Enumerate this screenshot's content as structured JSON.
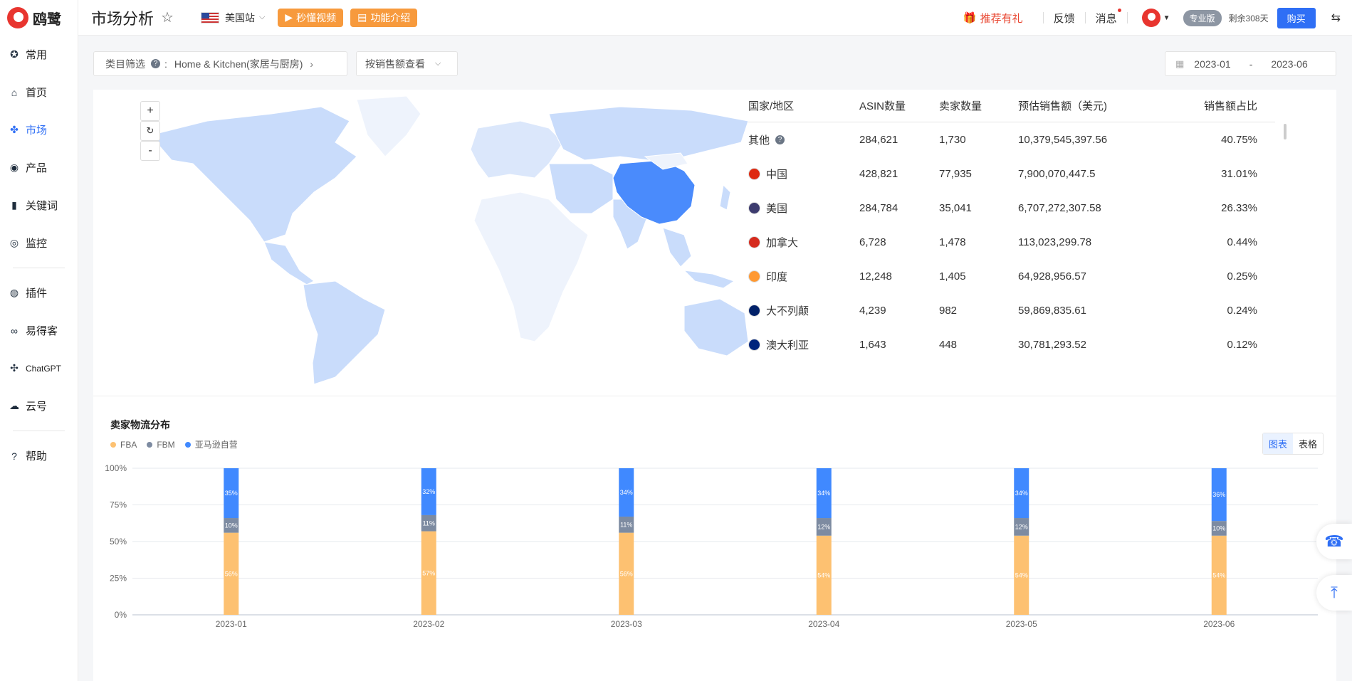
{
  "app": {
    "logo_text": "鸥鹭"
  },
  "sidebar": {
    "items": [
      {
        "label": "常用",
        "icon": "star-icon",
        "glyph": "✪"
      },
      {
        "label": "首页",
        "icon": "home-icon",
        "glyph": "⌂"
      },
      {
        "label": "市场",
        "icon": "grid-icon",
        "glyph": "✤"
      },
      {
        "label": "产品",
        "icon": "eye-icon",
        "glyph": "◉"
      },
      {
        "label": "关键词",
        "icon": "bar-chart-icon",
        "glyph": "▮"
      },
      {
        "label": "监控",
        "icon": "monitor-icon",
        "glyph": "◎"
      }
    ],
    "items2": [
      {
        "label": "插件",
        "icon": "chrome-icon",
        "glyph": "◍"
      },
      {
        "label": "易得客",
        "icon": "link-icon",
        "glyph": "∞"
      },
      {
        "label": "ChatGPT",
        "icon": "chatgpt-icon",
        "glyph": "✣"
      },
      {
        "label": "云号",
        "icon": "cloud-icon",
        "glyph": "☁"
      }
    ],
    "items3": [
      {
        "label": "帮助",
        "icon": "help-icon",
        "glyph": "?"
      }
    ]
  },
  "header": {
    "title": "市场分析",
    "site": "美国站",
    "btn_video": "秒懂视频",
    "btn_intro": "功能介绍",
    "gift": "推荐有礼",
    "feedback": "反馈",
    "messages": "消息",
    "plan": "专业版",
    "days_left": "剩余308天",
    "buy": "购买"
  },
  "filters": {
    "category_label": "类目筛选",
    "category_value": "Home & Kitchen(家居与厨房)",
    "view_mode": "按销售额查看",
    "date_start": "2023-01",
    "date_sep": "-",
    "date_end": "2023-06"
  },
  "table": {
    "headers": [
      "国家/地区",
      "ASIN数量",
      "卖家数量",
      "预估销售额（美元)",
      "销售额占比"
    ],
    "rows": [
      {
        "country": "其他",
        "asin": "284,621",
        "sellers": "1,730",
        "sales": "10,379,545,397.56",
        "share": "40.75%",
        "flag": "help"
      },
      {
        "country": "中国",
        "asin": "428,821",
        "sellers": "77,935",
        "sales": "7,900,070,447.5",
        "share": "31.01%",
        "flag": "#de2910"
      },
      {
        "country": "美国",
        "asin": "284,784",
        "sellers": "35,041",
        "sales": "6,707,272,307.58",
        "share": "26.33%",
        "flag": "#3c3b6e"
      },
      {
        "country": "加拿大",
        "asin": "6,728",
        "sellers": "1,478",
        "sales": "113,023,299.78",
        "share": "0.44%",
        "flag": "#d52b1e"
      },
      {
        "country": "印度",
        "asin": "12,248",
        "sellers": "1,405",
        "sales": "64,928,956.57",
        "share": "0.25%",
        "flag": "#ff9933"
      },
      {
        "country": "大不列颠",
        "asin": "4,239",
        "sellers": "982",
        "sales": "59,869,835.61",
        "share": "0.24%",
        "flag": "#012169"
      },
      {
        "country": "澳大利亚",
        "asin": "1,643",
        "sellers": "448",
        "sales": "30,781,293.52",
        "share": "0.12%",
        "flag": "#00247d"
      }
    ]
  },
  "chart": {
    "title": "卖家物流分布",
    "switch_chart": "图表",
    "switch_table": "表格"
  },
  "chart_data": {
    "type": "bar",
    "stacked": true,
    "categories": [
      "2023-01",
      "2023-02",
      "2023-03",
      "2023-04",
      "2023-05",
      "2023-06"
    ],
    "series": [
      {
        "name": "FBA",
        "color": "#fdc171",
        "values": [
          56,
          57,
          56,
          54,
          54,
          54
        ]
      },
      {
        "name": "FBM",
        "color": "#7d8ba1",
        "values": [
          10,
          11,
          11,
          12,
          12,
          10
        ]
      },
      {
        "name": "亚马逊自营",
        "color": "#4089ff",
        "values": [
          35,
          32,
          34,
          34,
          34,
          36
        ]
      }
    ],
    "y_ticks": [
      "0%",
      "25%",
      "50%",
      "75%",
      "100%"
    ],
    "ylim": [
      0,
      100
    ],
    "grid": true,
    "legend": "top-left"
  }
}
